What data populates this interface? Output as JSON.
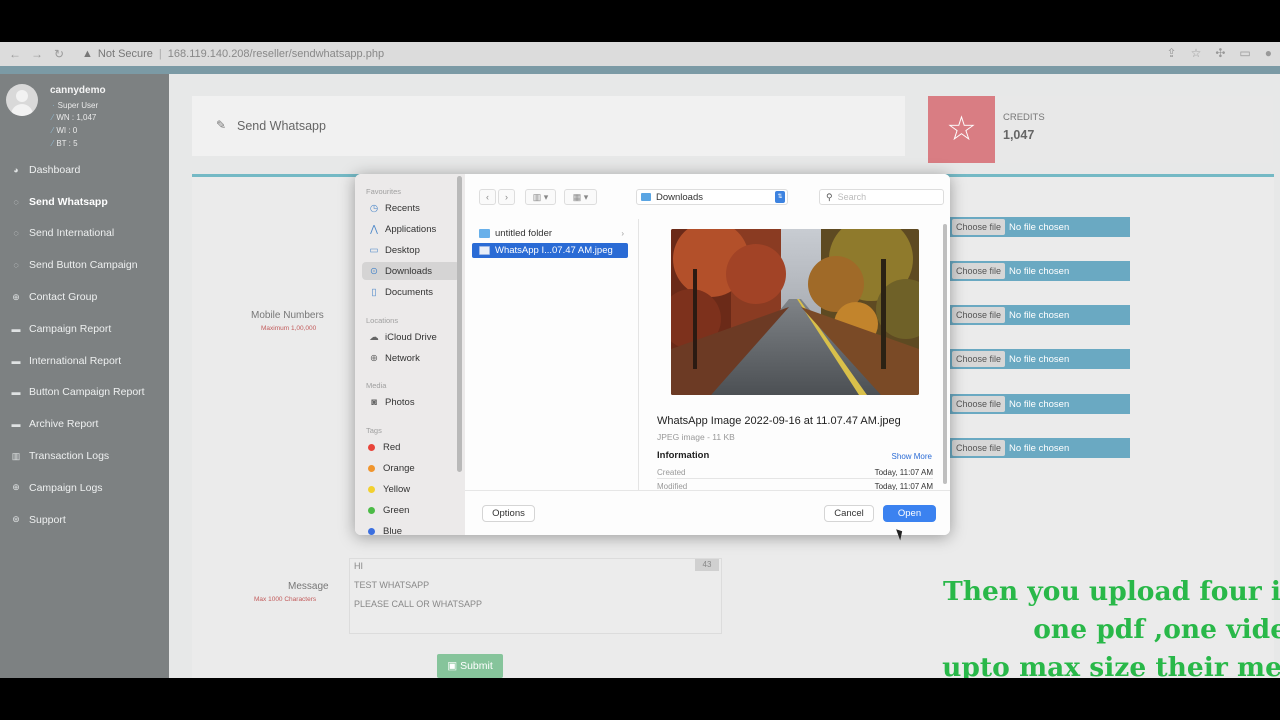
{
  "browser": {
    "security_label": "Not Secure",
    "url": "168.119.140.208/reseller/sendwhatsapp.php"
  },
  "user": {
    "name": "cannydemo",
    "role": "Super User",
    "stats": [
      "WN : 1,047",
      "WI : 0",
      "BT : 5"
    ]
  },
  "sidebar": {
    "items": [
      {
        "label": "Dashboard",
        "icon": "dashboard-icon"
      },
      {
        "label": "Send Whatsapp",
        "icon": "whatsapp-icon"
      },
      {
        "label": "Send International",
        "icon": "whatsapp-icon"
      },
      {
        "label": "Send Button Campaign",
        "icon": "whatsapp-icon"
      },
      {
        "label": "Contact Group",
        "icon": "globe-icon"
      },
      {
        "label": "Campaign Report",
        "icon": "folder-icon"
      },
      {
        "label": "International Report",
        "icon": "folder-icon"
      },
      {
        "label": "Button Campaign Report",
        "icon": "folder-icon"
      },
      {
        "label": "Archive Report",
        "icon": "folder-icon"
      },
      {
        "label": "Transaction Logs",
        "icon": "chart-icon"
      },
      {
        "label": "Campaign Logs",
        "icon": "globe-icon"
      },
      {
        "label": "Support",
        "icon": "lifebuoy-icon"
      }
    ],
    "active_index": 1
  },
  "page": {
    "title": "Send Whatsapp",
    "credits_label": "CREDITS",
    "credits_value": "1,047"
  },
  "form": {
    "mobile_label": "Mobile Numbers",
    "mobile_hint": "Maximum 1,00,000",
    "message_label": "Message",
    "message_hint": "Max 1000 Characters",
    "message_lines": [
      "HI",
      "TEST WHATSAPP",
      "PLEASE CALL OR WHATSAPP"
    ],
    "message_count": "43",
    "file_inputs": [
      {
        "button": "Choose file",
        "status": "No file chosen"
      },
      {
        "button": "Choose file",
        "status": "No file chosen"
      },
      {
        "button": "Choose file",
        "status": "No file chosen"
      },
      {
        "button": "Choose file",
        "status": "No file chosen"
      },
      {
        "button": "Choose file",
        "status": "No file chosen"
      },
      {
        "button": "Choose file",
        "status": "No file chosen"
      }
    ],
    "submit_label": "Submit"
  },
  "caption": [
    "Then you upload four images ,",
    "one pdf ,one video",
    "upto max size their mentioned"
  ],
  "dialog": {
    "sections": {
      "favourites": "Favourites",
      "locations": "Locations",
      "media": "Media",
      "tags": "Tags"
    },
    "favourites": [
      {
        "label": "Recents",
        "icon": "clock-icon"
      },
      {
        "label": "Applications",
        "icon": "applications-icon"
      },
      {
        "label": "Desktop",
        "icon": "desktop-icon"
      },
      {
        "label": "Downloads",
        "icon": "downloads-icon",
        "selected": true
      },
      {
        "label": "Documents",
        "icon": "document-icon"
      }
    ],
    "locations": [
      {
        "label": "iCloud Drive",
        "icon": "cloud-icon"
      },
      {
        "label": "Network",
        "icon": "network-icon"
      }
    ],
    "media": [
      {
        "label": "Photos",
        "icon": "camera-icon"
      }
    ],
    "tags": [
      {
        "label": "Red",
        "color": "#e8443a"
      },
      {
        "label": "Orange",
        "color": "#f0952d"
      },
      {
        "label": "Yellow",
        "color": "#f2d02f"
      },
      {
        "label": "Green",
        "color": "#4cbb47"
      },
      {
        "label": "Blue",
        "color": "#3b6fe0"
      }
    ],
    "location": "Downloads",
    "search_placeholder": "Search",
    "files": [
      {
        "name": "untitled folder",
        "kind": "folder"
      },
      {
        "name": "WhatsApp I...07.47 AM.jpeg",
        "kind": "image",
        "selected": true
      }
    ],
    "preview": {
      "filename": "WhatsApp Image 2022-09-16 at 11.07.47 AM.jpeg",
      "type": "JPEG image - 11 KB",
      "info_label": "Information",
      "show_more": "Show More",
      "created_label": "Created",
      "created_value": "Today, 11:07 AM",
      "modified_label": "Modified",
      "modified_value": "Today, 11:07 AM"
    },
    "options_label": "Options",
    "cancel_label": "Cancel",
    "open_label": "Open"
  }
}
